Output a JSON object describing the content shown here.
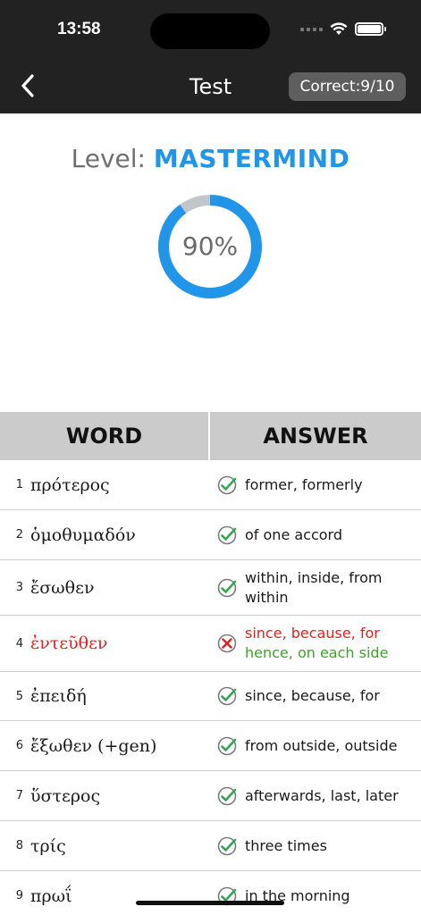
{
  "status": {
    "time": "13:58"
  },
  "header": {
    "title": "Test",
    "badge": "Correct:9/10"
  },
  "level": {
    "label": "Level:",
    "value": "MASTERMIND"
  },
  "progress": {
    "percent": 90,
    "label": "90%",
    "color": "#2196e8",
    "track_color": "#c0c6ca"
  },
  "table": {
    "headers": [
      "WORD",
      "ANSWER"
    ],
    "rows": [
      {
        "num": "1",
        "word": "πρότερος",
        "answer": "former, formerly",
        "correct": true
      },
      {
        "num": "2",
        "word": "ὁμοθυμαδόν",
        "answer": "of one accord",
        "correct": true
      },
      {
        "num": "3",
        "word": "ἔσωθεν",
        "answer": "within, inside, from within",
        "correct": true
      },
      {
        "num": "4",
        "word": "ἐντεῦθεν",
        "answer": "since, because, for",
        "expected": "hence, on each side",
        "correct": false
      },
      {
        "num": "5",
        "word": "ἐπειδή",
        "answer": "since, because, for",
        "correct": true
      },
      {
        "num": "6",
        "word": "ἔξωθεν (+gen)",
        "answer": "from outside, outside",
        "correct": true
      },
      {
        "num": "7",
        "word": "ὕστερος",
        "answer": "afterwards, last, later",
        "correct": true
      },
      {
        "num": "8",
        "word": "τρίς",
        "answer": "three times",
        "correct": true
      },
      {
        "num": "9",
        "word": "πρωΐ",
        "answer": "in the morning",
        "correct": true
      }
    ]
  }
}
